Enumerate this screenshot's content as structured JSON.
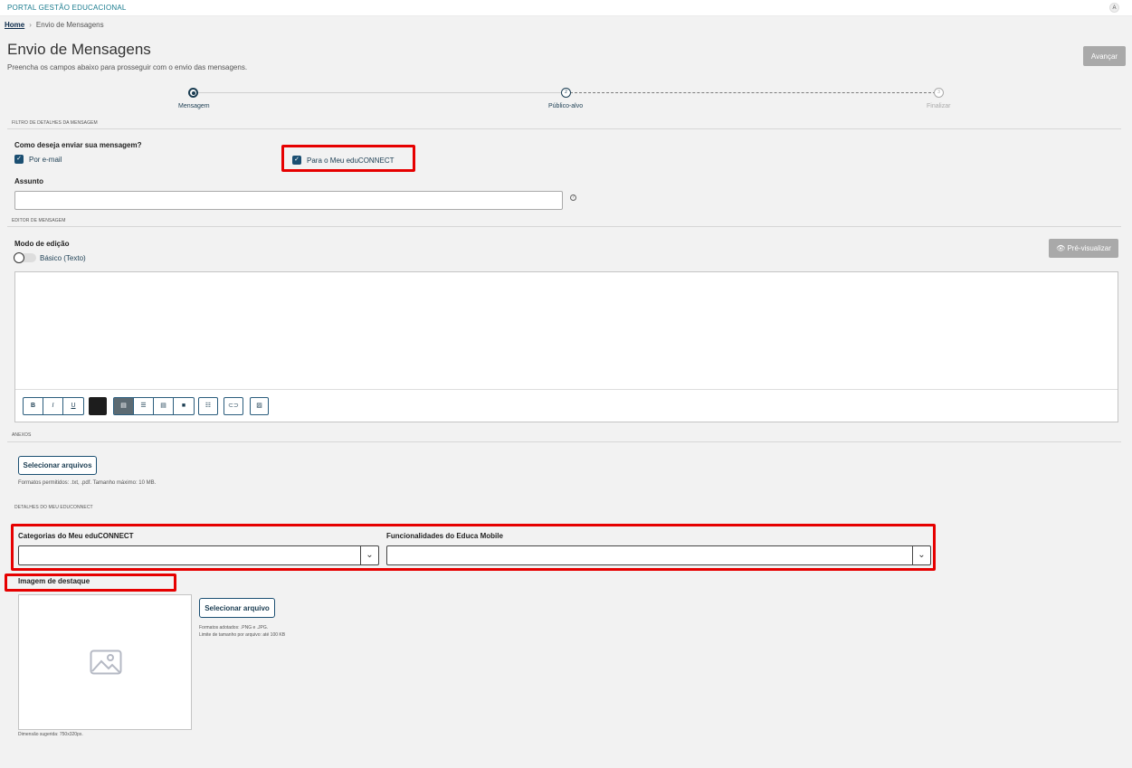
{
  "portal": {
    "title": "PORTAL GESTÃO EDUCACIONAL",
    "avatar": "A"
  },
  "breadcrumb": {
    "home": "Home",
    "current": "Envio de Mensagens"
  },
  "page": {
    "title": "Envio de Mensagens",
    "subtitle": "Preencha os campos abaixo para prosseguir com o envio das mensagens."
  },
  "actions": {
    "next": "Avançar"
  },
  "stepper": {
    "steps": [
      {
        "number": "",
        "label": "Mensagem",
        "state": "active"
      },
      {
        "number": "2",
        "label": "Público-alvo",
        "state": "current"
      },
      {
        "number": "3",
        "label": "Finalizar",
        "state": "disabled"
      }
    ]
  },
  "filters": {
    "section_title": "FILTRO DE DETALHES DA MENSAGEM",
    "send_question": "Como deseja enviar sua mensagem?",
    "options": [
      {
        "label": "Por e-mail",
        "checked": true
      },
      {
        "label": "Para o Meu eduCONNECT",
        "checked": true
      }
    ],
    "subject_label": "Assunto",
    "subject_value": "",
    "help_icon": "?"
  },
  "editor": {
    "section_title": "EDITOR DE MENSAGEM",
    "mode_label": "Modo de edição",
    "toggle_label": "Básico (Texto)",
    "preview_label": "Pré-visualizar",
    "toolbar": {
      "bold": "B",
      "italic": "I",
      "underline": "U"
    }
  },
  "attachments": {
    "section_title": "ANEXOS",
    "select_label": "Selecionar arquivos",
    "formats_note": "Formatos permitidos: .txt, .pdf. Tamanho máximo: 10 MB."
  },
  "educonnect": {
    "section_title": "DETALHES DO MEU EDUCONNECT",
    "categories_label": "Categorias do Meu eduCONNECT",
    "categories_value": "",
    "features_label": "Funcionalidades do Educa Mobile",
    "features_value": "",
    "image_label": "Imagem de destaque",
    "image_select": "Selecionar arquivo",
    "image_formats": "Formatos adotados: .PNG e .JPG.",
    "image_size": "Limite de tamanho por arquivo: até 100 KB",
    "image_dimension": "Dimensão sugerida: 750x320px."
  },
  "colors": {
    "primary": "#1b4f72",
    "highlight": "#e60000",
    "disabled_button": "#a9a9a9"
  }
}
